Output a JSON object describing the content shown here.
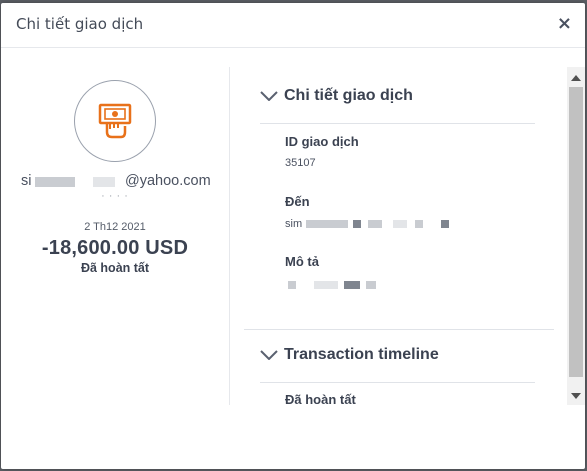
{
  "dialog": {
    "title": "Chi tiết giao dịch",
    "close_label": "×"
  },
  "summary": {
    "icon": "money-hand-icon",
    "email_prefix": "si",
    "email_suffix": "@yahoo.com",
    "sub_line": "· · · ·",
    "date": "2 Th12 2021",
    "amount": "-18,600.00 USD",
    "status": "Đã hoàn tất"
  },
  "details": {
    "heading": "Chi tiết giao dịch",
    "fields": [
      {
        "label": "ID giao dịch",
        "value": "35107"
      },
      {
        "label": "Đến",
        "value": "sim"
      },
      {
        "label": "Mô tả",
        "value": ""
      }
    ]
  },
  "timeline": {
    "heading": "Transaction timeline",
    "first_status": "Đã hoàn tất"
  },
  "colors": {
    "accent_icon": "#e8711a",
    "text": "#3b4251"
  }
}
